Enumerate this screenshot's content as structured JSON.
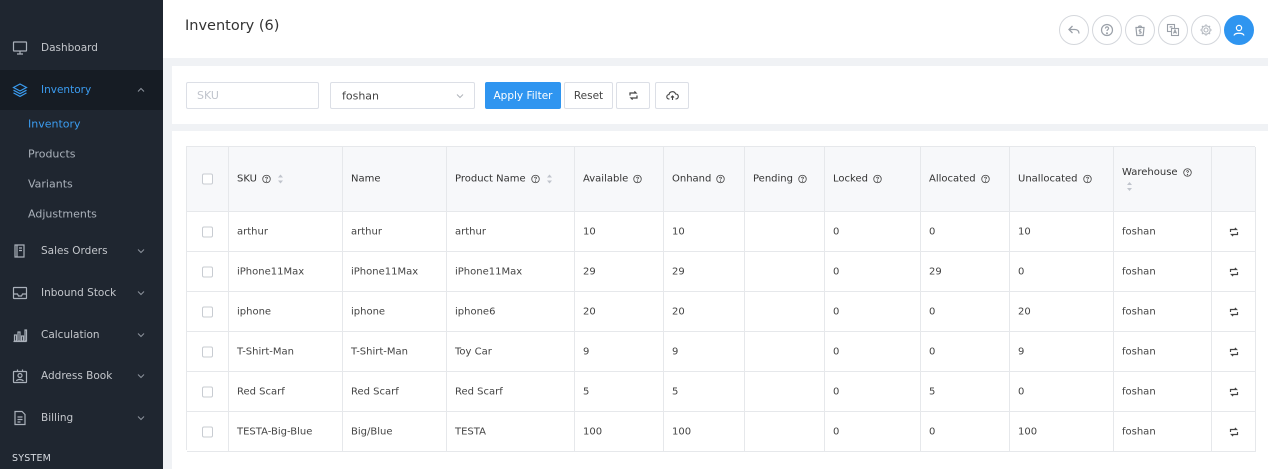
{
  "sidebar": {
    "items": [
      {
        "label": "Dashboard",
        "icon": "monitor-icon",
        "expandable": false
      },
      {
        "label": "Inventory",
        "icon": "layers-icon",
        "expandable": true,
        "expanded": true,
        "active": true
      },
      {
        "label": "Sales Orders",
        "icon": "book-icon",
        "expandable": true
      },
      {
        "label": "Inbound Stock",
        "icon": "inbox-icon",
        "expandable": true
      },
      {
        "label": "Calculation",
        "icon": "bar-chart-icon",
        "expandable": true
      },
      {
        "label": "Address Book",
        "icon": "person-box-icon",
        "expandable": true
      },
      {
        "label": "Billing",
        "icon": "document-icon",
        "expandable": true
      }
    ],
    "inventory_subitems": [
      {
        "label": "Inventory",
        "active": true
      },
      {
        "label": "Products"
      },
      {
        "label": "Variants"
      },
      {
        "label": "Adjustments"
      }
    ],
    "section_label": "SYSTEM"
  },
  "header": {
    "title": "Inventory (6)",
    "buttons": [
      "reply-icon",
      "help-icon",
      "shopify-icon",
      "translate-icon",
      "gear-icon",
      "user-icon"
    ]
  },
  "filters": {
    "sku_placeholder": "SKU",
    "sku_value": "",
    "warehouse_selected": "foshan",
    "apply_label": "Apply Filter",
    "reset_label": "Reset"
  },
  "table": {
    "headers": {
      "sku": "SKU",
      "name": "Name",
      "product_name": "Product Name",
      "available": "Available",
      "onhand": "Onhand",
      "pending": "Pending",
      "locked": "Locked",
      "allocated": "Allocated",
      "unallocated": "Unallocated",
      "warehouse": "Warehouse"
    },
    "rows": [
      {
        "sku": "arthur",
        "name": "arthur",
        "product_name": "arthur",
        "available": "10",
        "onhand": "10",
        "pending": "",
        "locked": "0",
        "allocated": "0",
        "unallocated": "10",
        "warehouse": "foshan"
      },
      {
        "sku": "iPhone11Max",
        "name": "iPhone11Max",
        "product_name": "iPhone11Max",
        "available": "29",
        "onhand": "29",
        "pending": "",
        "locked": "0",
        "allocated": "29",
        "unallocated": "0",
        "warehouse": "foshan"
      },
      {
        "sku": "iphone",
        "name": "iphone",
        "product_name": "iphone6",
        "available": "20",
        "onhand": "20",
        "pending": "",
        "locked": "0",
        "allocated": "0",
        "unallocated": "20",
        "warehouse": "foshan"
      },
      {
        "sku": "T-Shirt-Man",
        "name": "T-Shirt-Man",
        "product_name": "Toy Car",
        "available": "9",
        "onhand": "9",
        "pending": "",
        "locked": "0",
        "allocated": "0",
        "unallocated": "9",
        "warehouse": "foshan"
      },
      {
        "sku": "Red Scarf",
        "name": "Red Scarf",
        "product_name": "Red Scarf",
        "available": "5",
        "onhand": "5",
        "pending": "",
        "locked": "0",
        "allocated": "5",
        "unallocated": "0",
        "warehouse": "foshan"
      },
      {
        "sku": "TESTA-Big-Blue",
        "name": "Big/Blue",
        "product_name": "TESTA",
        "available": "100",
        "onhand": "100",
        "pending": "",
        "locked": "0",
        "allocated": "0",
        "unallocated": "100",
        "warehouse": "foshan"
      }
    ]
  },
  "colors": {
    "sidebar_bg": "#1f2630",
    "accent": "#2f95f0",
    "active_text": "#3b9cf0"
  }
}
